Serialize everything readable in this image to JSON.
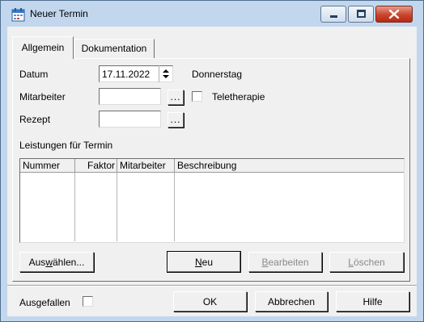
{
  "window": {
    "title": "Neuer Termin",
    "icon": "calendar-icon",
    "controls": [
      "minimize-icon",
      "maximize-icon",
      "close-icon"
    ]
  },
  "tabs": [
    {
      "label": "Allgemein",
      "active": true
    },
    {
      "label": "Dokumentation",
      "active": false
    }
  ],
  "form": {
    "datum_label": "Datum",
    "datum_value": "17.11.2022",
    "weekday": "Donnerstag",
    "mitarbeiter_label": "Mitarbeiter",
    "mitarbeiter_value": "",
    "rezept_label": "Rezept",
    "rezept_value": "",
    "browse_label": "...",
    "teletherapie_label": "Teletherapie",
    "teletherapie_checked": false
  },
  "services": {
    "label": "Leistungen für Termin",
    "columns": [
      "Nummer",
      "Faktor",
      "Mitarbeiter",
      "Beschreibung"
    ],
    "rows": []
  },
  "actions": {
    "select": {
      "pre": "Aus",
      "accel": "w",
      "post": "ählen..."
    },
    "new": {
      "pre": "",
      "accel": "N",
      "post": "eu"
    },
    "edit": {
      "pre": "",
      "accel": "B",
      "post": "earbeiten"
    },
    "delete": {
      "pre": "",
      "accel": "L",
      "post": "öschen"
    }
  },
  "footer": {
    "ausgefallen_label": "Ausgefallen",
    "ausgefallen_checked": false,
    "ok_label": "OK",
    "cancel_label": "Abbrechen",
    "help_label": "Hilfe"
  },
  "colors": {
    "frame": "#c2d7ee",
    "face": "#f0f0f0",
    "close_button": "#c8452f"
  }
}
